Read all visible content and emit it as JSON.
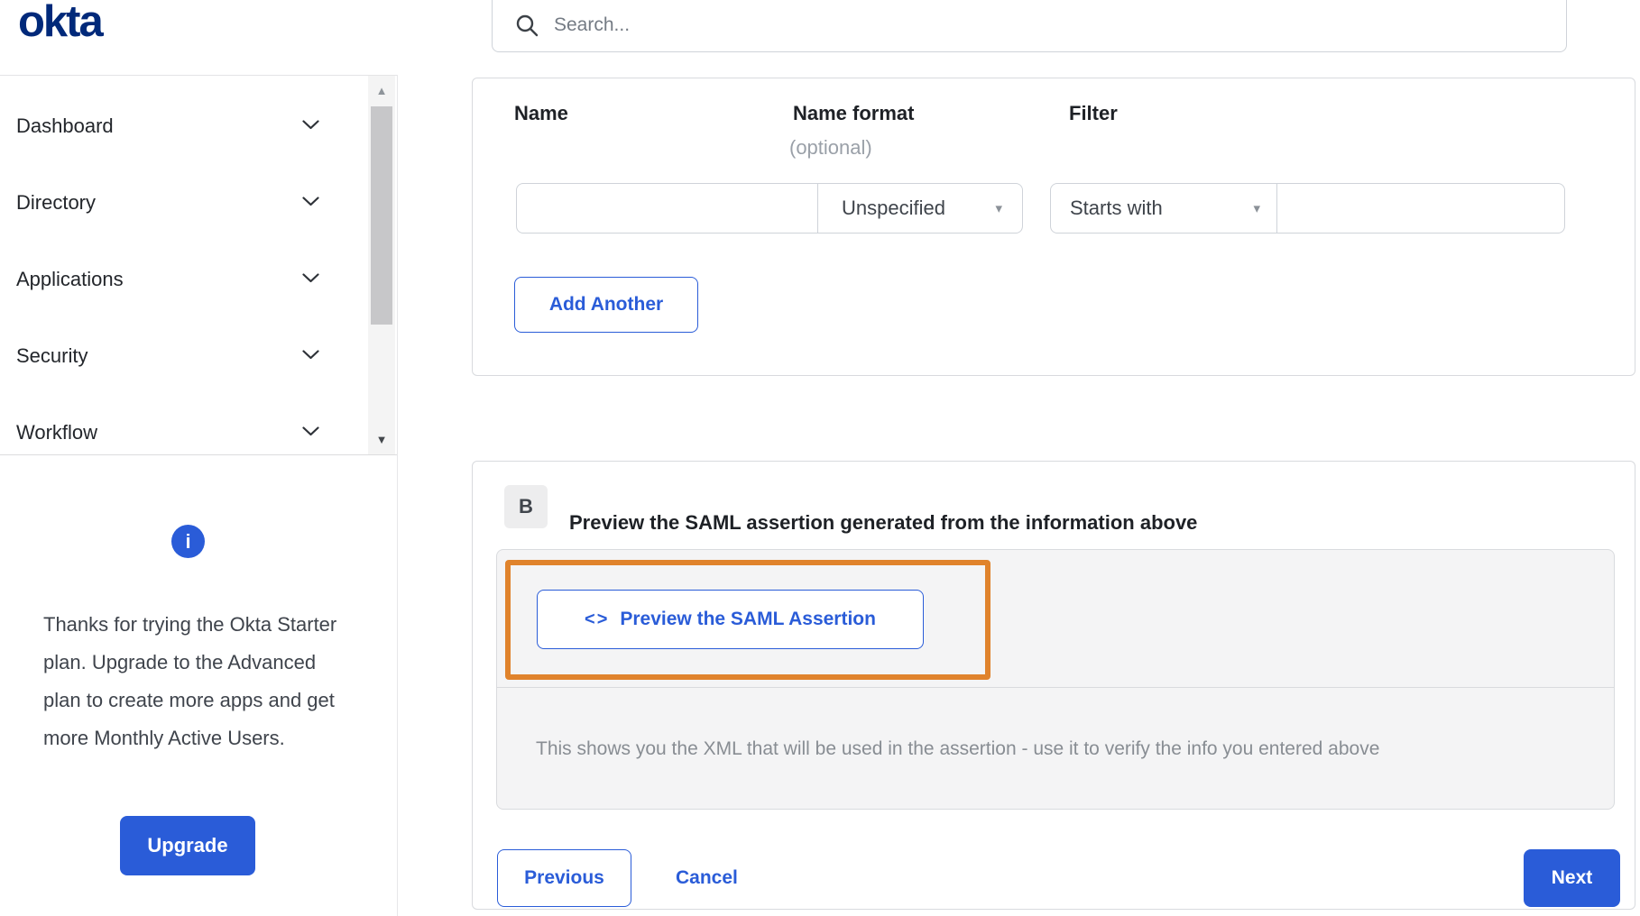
{
  "header": {
    "logo_text": "okta",
    "search_placeholder": "Search..."
  },
  "sidebar": {
    "items": [
      {
        "label": "Dashboard"
      },
      {
        "label": "Directory"
      },
      {
        "label": "Applications"
      },
      {
        "label": "Security"
      },
      {
        "label": "Workflow"
      }
    ],
    "upgrade_message": "Thanks for trying the Okta Starter plan. Upgrade to the Advanced plan to create more apps and get more Monthly Active Users.",
    "upgrade_button_label": "Upgrade"
  },
  "attribute_form": {
    "name_label": "Name",
    "name_format_label": "Name format",
    "name_format_hint": "(optional)",
    "filter_label": "Filter",
    "name_value": "",
    "name_format_value": "Unspecified",
    "filter_type_value": "Starts with",
    "filter_value": "",
    "add_another_label": "Add Another"
  },
  "preview_section": {
    "badge": "B",
    "title": "Preview the SAML assertion generated from the information above",
    "button_icon": "<>",
    "button_label": "Preview the SAML Assertion",
    "description": "This shows you the XML that will be used in the assertion - use it to verify the info you entered above"
  },
  "footer": {
    "previous_label": "Previous",
    "cancel_label": "Cancel",
    "next_label": "Next"
  },
  "icons": {
    "caret_down": "▾",
    "scroll_up": "▲",
    "scroll_down": "▼",
    "info": "i"
  },
  "colors": {
    "accent_blue": "#2a5cd8",
    "logo_navy": "#00297a",
    "highlight_orange": "#e0832c",
    "panel_gray": "#f4f4f5"
  }
}
